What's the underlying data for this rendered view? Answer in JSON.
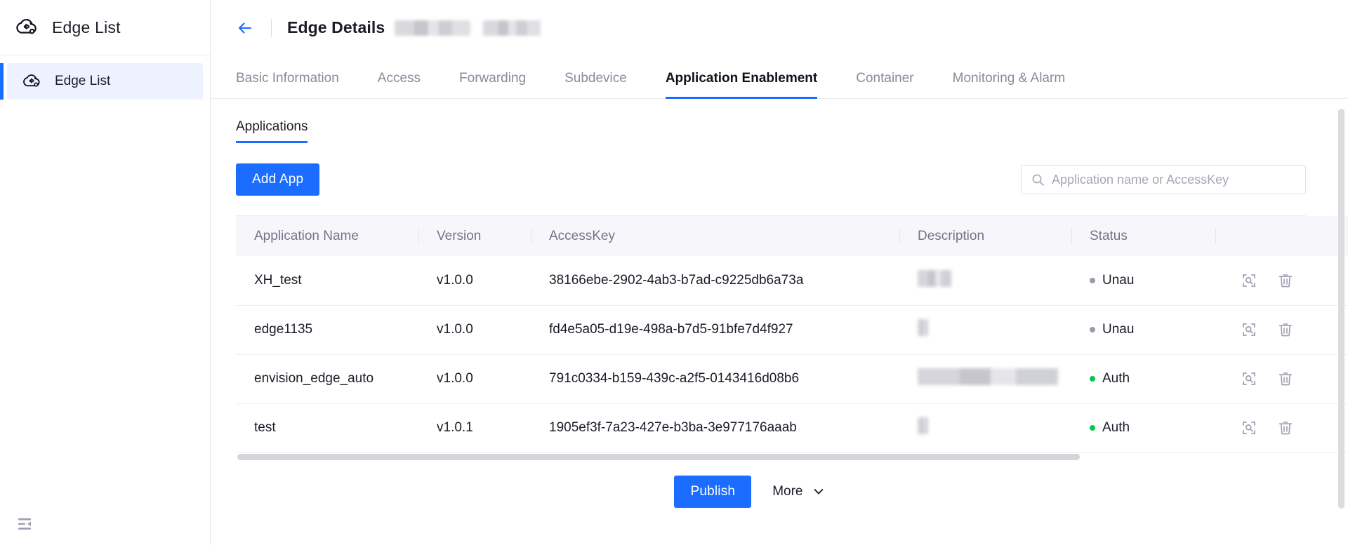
{
  "sidebar": {
    "logo_icon": "edge-cloud-icon",
    "title": "Edge List",
    "items": [
      {
        "label": "Edge List",
        "icon": "edge-cloud-icon",
        "active": true
      }
    ],
    "collapse_icon": "sidebar-collapse-icon"
  },
  "header": {
    "back_icon": "arrow-left-icon",
    "title": "Edge Details",
    "redacted_1": "",
    "redacted_2": ""
  },
  "tabs": [
    {
      "label": "Basic Information",
      "active": false
    },
    {
      "label": "Access",
      "active": false
    },
    {
      "label": "Forwarding",
      "active": false
    },
    {
      "label": "Subdevice",
      "active": false
    },
    {
      "label": "Application Enablement",
      "active": true
    },
    {
      "label": "Container",
      "active": false
    },
    {
      "label": "Monitoring & Alarm",
      "active": false
    }
  ],
  "subtabs": [
    {
      "label": "Applications",
      "active": true
    }
  ],
  "toolbar": {
    "add_app_label": "Add App",
    "search_icon": "search-icon",
    "search_placeholder": "Application name or AccessKey",
    "search_value": ""
  },
  "table": {
    "columns": [
      "Application Name",
      "Version",
      "AccessKey",
      "Description",
      "Status",
      ""
    ],
    "rows": [
      {
        "name": "XH_test",
        "version": "v1.0.0",
        "accesskey": "38166ebe-2902-4ab3-b7ad-c9225db6a73a",
        "description_redacted_width": 48,
        "status": "Unau",
        "status_color": "#9a9aac",
        "view_icon": "view-detail-icon",
        "delete_icon": "trash-icon"
      },
      {
        "name": "edge1135",
        "version": "v1.0.0",
        "accesskey": "fd4e5a05-d19e-498a-b7d5-91bfe7d4f927",
        "description_redacted_width": 15,
        "status": "Unau",
        "status_color": "#9a9aac",
        "view_icon": "view-detail-icon",
        "delete_icon": "trash-icon"
      },
      {
        "name": "envision_edge_auto",
        "version": "v1.0.0",
        "accesskey": "791c0334-b159-439c-a2f5-0143416d08b6",
        "description_redacted_width": 200,
        "status": "Auth",
        "status_color": "#00c853",
        "view_icon": "view-detail-icon",
        "delete_icon": "trash-icon"
      },
      {
        "name": "test",
        "version": "v1.0.1",
        "accesskey": "1905ef3f-7a23-427e-b3ba-3e977176aaab",
        "description_redacted_width": 15,
        "status": "Auth",
        "status_color": "#00c853",
        "view_icon": "view-detail-icon",
        "delete_icon": "trash-icon"
      }
    ]
  },
  "footer": {
    "publish_label": "Publish",
    "more_label": "More",
    "more_icon": "chevron-down-icon"
  },
  "colors": {
    "accent": "#1a6dff",
    "status_authorized": "#00c853",
    "status_unauthorized": "#9a9aac",
    "header_bg": "#f7f7fb"
  }
}
